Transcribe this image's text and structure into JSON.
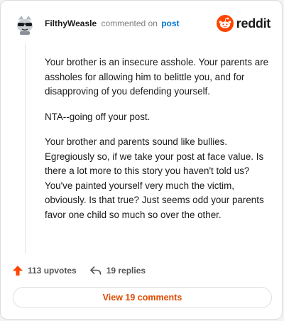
{
  "header": {
    "username": "FilthyWeasle",
    "action": "commented on",
    "post_link": "post",
    "avatar_icon": "snoo-sunglasses-avatar-icon",
    "brand_icon": "reddit-snoo-icon",
    "brand_name": "reddit"
  },
  "comment": {
    "paragraphs": [
      "Your brother is an insecure asshole. Your parents are assholes for allowing him to belittle you, and for disapproving of you defending yourself.",
      "NTA--going off your post.",
      "Your brother and parents sound like bullies. Egregiously so, if we take your post at face value. Is there a lot more to this story you haven't told us? You've painted yourself very much the victim, obviously. Is that true? Just seems odd your parents favor one child so much so over the other."
    ]
  },
  "actions": {
    "upvotes": "113 upvotes",
    "upvote_icon": "upvote-arrow-icon",
    "replies": "19 replies",
    "reply_icon": "reply-arrow-icon"
  },
  "footer": {
    "view_comments": "View 19 comments"
  },
  "colors": {
    "brand": "#ff4500",
    "link": "#0079d3",
    "button_text": "#e04a00"
  }
}
